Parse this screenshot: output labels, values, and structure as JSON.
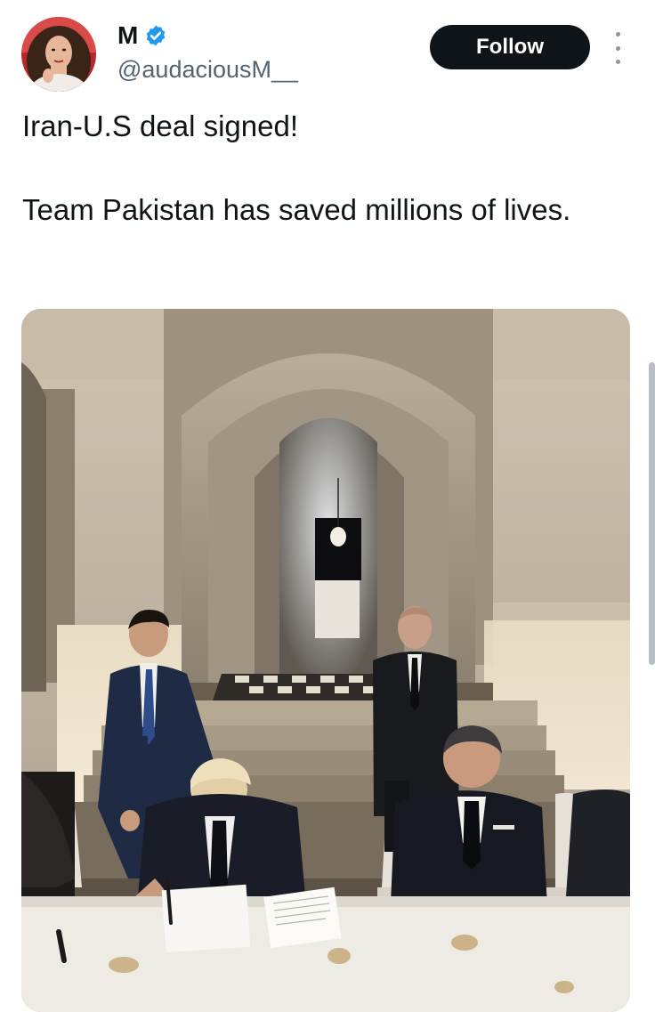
{
  "author": {
    "display_name": "M",
    "handle": "@audaciousM__",
    "verified": true,
    "avatar_icon": "profile-photo",
    "verified_icon": "verified-badge-icon"
  },
  "actions": {
    "follow_label": "Follow",
    "more_icon": "more-options-icon"
  },
  "tweet": {
    "lines": [
      "Iran-U.S deal signed!",
      "Team Pakistan has saved millions of lives."
    ]
  },
  "media": {
    "type": "video-still"
  },
  "colors": {
    "text": "#0f1419",
    "secondary": "#536471",
    "verified": "#1d9bf0",
    "follow_bg": "#0f1419",
    "follow_text": "#ffffff"
  }
}
